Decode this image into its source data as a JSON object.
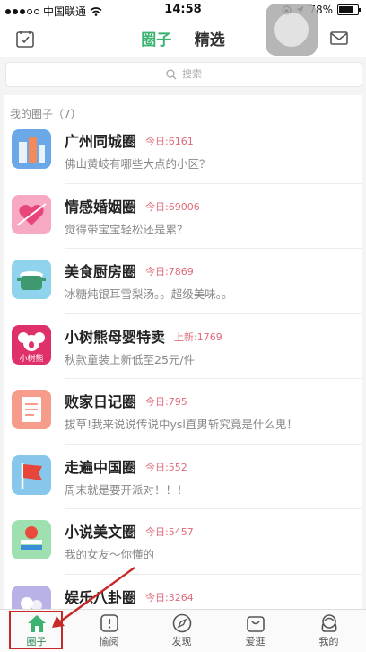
{
  "status": {
    "carrier": "中国联通",
    "time": "14:58",
    "battery": "78%"
  },
  "nav": {
    "tab_active": "圈子",
    "tab_other": "精选"
  },
  "search": {
    "placeholder": "搜索"
  },
  "section_title": "我的圈子（7）",
  "items": [
    {
      "name": "广州同城圈",
      "badge": "今日:6161",
      "desc": "佛山黄岐有哪些大点的小区？",
      "icon": "city-icon",
      "color": "#6aa8e8"
    },
    {
      "name": "情感婚姻圈",
      "badge": "今日:69006",
      "desc": "觉得带宝宝轻松还是累？",
      "icon": "heart-icon",
      "color": "#f7a8c2"
    },
    {
      "name": "美食厨房圈",
      "badge": "今日:7869",
      "desc": "冰糖炖银耳雪梨汤。。超级美味。。",
      "icon": "pot-icon",
      "color": "#8fd3ec"
    },
    {
      "name": "小树熊母婴特卖",
      "badge": "上新:1769",
      "desc": "秋款童装上新低至25元/件",
      "icon": "koala-icon",
      "color": "#e0306a",
      "label": "小树熊"
    },
    {
      "name": "败家日记圈",
      "badge": "今日:795",
      "desc": "拔草!我来说说传说中ysl直男斩究竟是什么鬼！",
      "icon": "notebook-icon",
      "color": "#f59c8a"
    },
    {
      "name": "走遍中国圈",
      "badge": "今日:552",
      "desc": "周末就是要开派对！！！",
      "icon": "flag-icon",
      "color": "#87c7ec"
    },
    {
      "name": "小说美文圈",
      "badge": "今日:5457",
      "desc": "我的女友～你懂的",
      "icon": "book-icon",
      "color": "#9fe0b0"
    },
    {
      "name": "娱乐八卦圈",
      "badge": "今日:3264",
      "desc": "",
      "icon": "gossip-icon",
      "color": "#b9b2e6"
    }
  ],
  "tabbar": [
    {
      "label": "圈子",
      "icon": "home-icon"
    },
    {
      "label": "愉阅",
      "icon": "reading-icon"
    },
    {
      "label": "发现",
      "icon": "compass-icon"
    },
    {
      "label": "爱逛",
      "icon": "shopping-bag-icon"
    },
    {
      "label": "我的",
      "icon": "profile-icon"
    }
  ],
  "colors": {
    "accent": "#3cb371",
    "badge": "#e06a7a",
    "highlight": "#c92828"
  }
}
